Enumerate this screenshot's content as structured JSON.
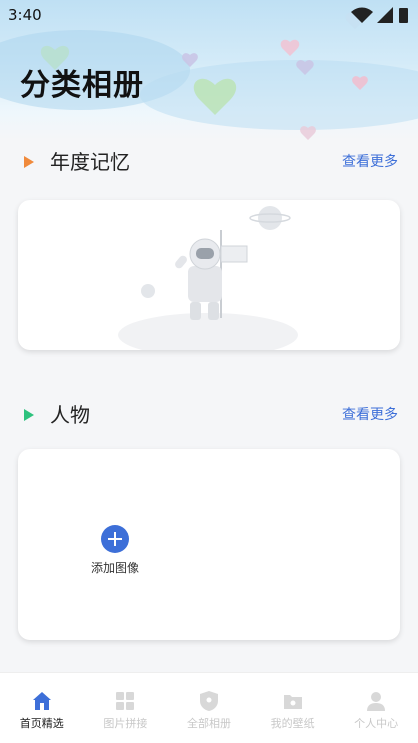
{
  "status_bar": {
    "time": "3:40"
  },
  "page": {
    "title": "分类相册"
  },
  "sections": [
    {
      "title": "年度记忆",
      "more_label": "查看更多",
      "arrow_color": "#f08a3c"
    },
    {
      "title": "人物",
      "more_label": "查看更多",
      "arrow_color": "#2ec27e"
    }
  ],
  "people_card": {
    "add_label": "添加图像",
    "add_icon": "plus-icon"
  },
  "tabbar": {
    "accent": "#3d6fd8",
    "items": [
      {
        "label": "首页精选",
        "icon": "home-icon",
        "active": true
      },
      {
        "label": "图片拼接",
        "icon": "grid-icon",
        "active": false
      },
      {
        "label": "全部相册",
        "icon": "shield-icon",
        "active": false
      },
      {
        "label": "我的壁纸",
        "icon": "folder-icon",
        "active": false
      },
      {
        "label": "个人中心",
        "icon": "person-icon",
        "active": false
      }
    ]
  }
}
